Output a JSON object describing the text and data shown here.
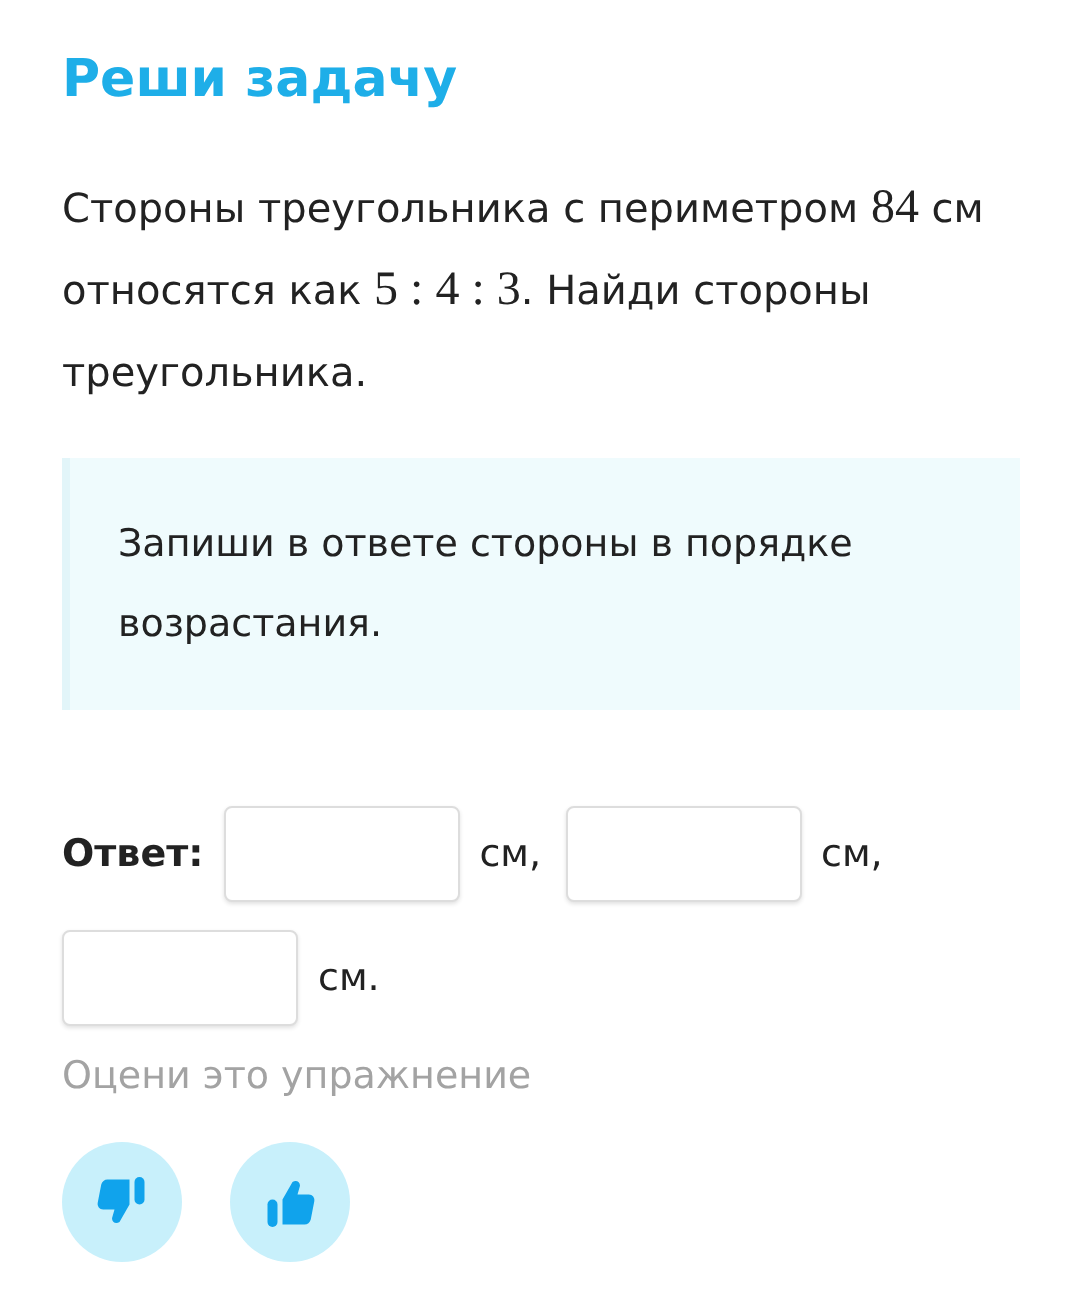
{
  "title": "Реши задачу",
  "problem": [
    {
      "kind": "text",
      "text": "Стороны треугольника с периметром "
    },
    {
      "kind": "math",
      "text": "84"
    },
    {
      "kind": "text",
      "text": " см относятся как "
    },
    {
      "kind": "math",
      "text": "5 : 4 : 3"
    },
    {
      "kind": "text",
      "text": ". Найди стороны треугольника."
    }
  ],
  "hint": "Запиши в ответе стороны в порядке возрастания.",
  "answer": {
    "label": "Ответ:",
    "items": [
      {
        "kind": "field"
      },
      {
        "kind": "unit",
        "text": "см,"
      },
      {
        "kind": "field"
      },
      {
        "kind": "unit",
        "text": "см,"
      },
      {
        "kind": "field"
      },
      {
        "kind": "unit",
        "text": "см."
      }
    ]
  },
  "rating": {
    "prompt": "Оцени это упражнение",
    "buttons": [
      {
        "kind": "dislike"
      },
      {
        "kind": "like"
      }
    ]
  }
}
